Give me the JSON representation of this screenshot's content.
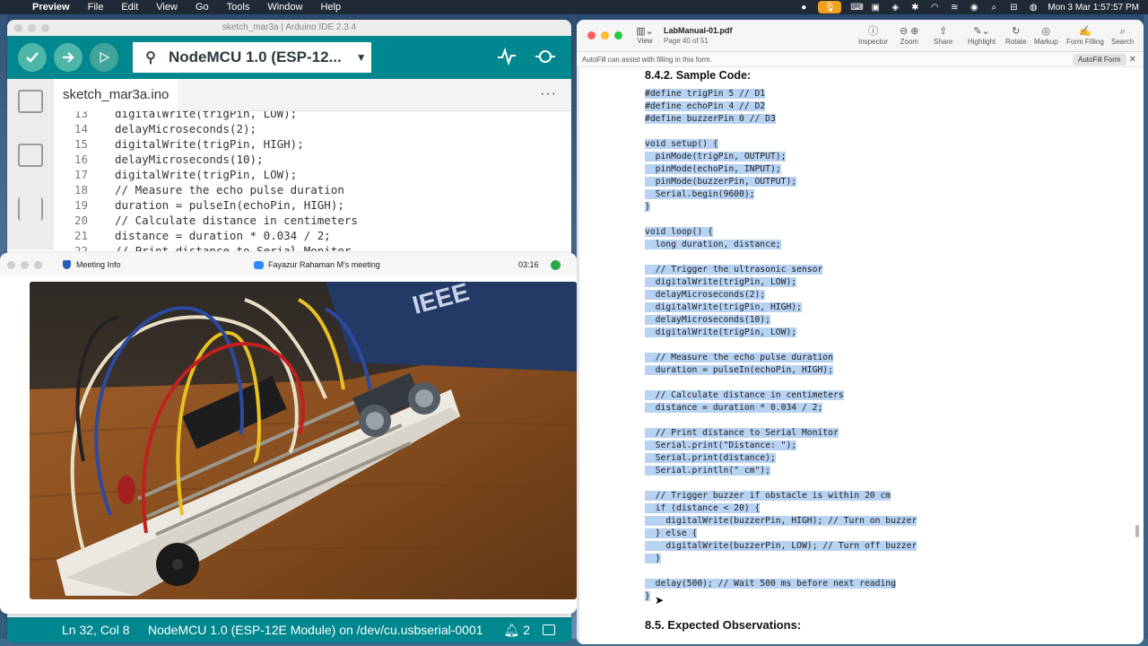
{
  "menubar": {
    "app": "Preview",
    "items": [
      "File",
      "Edit",
      "View",
      "Go",
      "Tools",
      "Window",
      "Help"
    ],
    "datetime": "Mon 3 Mar  1:57:57 PM"
  },
  "arduino": {
    "window_title": "sketch_mar3a | Arduino IDE 2.3.4",
    "board": "NodeMCU 1.0 (ESP-12...",
    "tab_file": "sketch_mar3a.ino",
    "tab_more": "···",
    "code_lines": [
      {
        "n": "13",
        "t": "digitalWrite(trigPin, LOW);"
      },
      {
        "n": "14",
        "t": "delayMicroseconds(2);"
      },
      {
        "n": "15",
        "t": "digitalWrite(trigPin, HIGH);"
      },
      {
        "n": "16",
        "t": "delayMicroseconds(10);"
      },
      {
        "n": "17",
        "t": "digitalWrite(trigPin, LOW);"
      },
      {
        "n": "18",
        "t": "// Measure the echo pulse duration"
      },
      {
        "n": "19",
        "t": "duration = pulseIn(echoPin, HIGH);"
      },
      {
        "n": "20",
        "t": "// Calculate distance in centimeters"
      },
      {
        "n": "21",
        "t": "distance = duration * 0.034 / 2;"
      },
      {
        "n": "22",
        "t": "// Print distance to Serial Monitor"
      }
    ],
    "status": {
      "position": "Ln 32, Col 8",
      "board_port": "NodeMCU 1.0 (ESP-12E Module) on /dev/cu.usbserial-0001",
      "notifications": "2"
    }
  },
  "meeting": {
    "info_label": "Meeting Info",
    "name": "Fayazur Rahaman M's meeting",
    "elapsed": "03:16",
    "video_text": "IEEE"
  },
  "preview": {
    "doc_name": "LabManual-01.pdf",
    "page_info": "Page 40 of 51",
    "view_label": "View",
    "tools": [
      "Inspector",
      "Zoom",
      "Share",
      "Highlight",
      "Rotate",
      "Markup",
      "Form Filling",
      "Search"
    ],
    "autofill_text": "AutoFill can assist with filling in this form.",
    "autofill_button": "AutoFill Form",
    "section_heading": "8.4.2.  Sample Code:",
    "pdf_code": [
      "#define trigPin 5 // D1",
      "#define echoPin 4 // D2",
      "#define buzzerPin 0 // D3",
      "",
      "void setup() {",
      "  pinMode(trigPin, OUTPUT);",
      "  pinMode(echoPin, INPUT);",
      "  pinMode(buzzerPin, OUTPUT);",
      "  Serial.begin(9600);",
      "}",
      "",
      "void loop() {",
      "  long duration, distance;",
      "",
      "  // Trigger the ultrasonic sensor",
      "  digitalWrite(trigPin, LOW);",
      "  delayMicroseconds(2);",
      "  digitalWrite(trigPin, HIGH);",
      "  delayMicroseconds(10);",
      "  digitalWrite(trigPin, LOW);",
      "",
      "  // Measure the echo pulse duration",
      "  duration = pulseIn(echoPin, HIGH);",
      "",
      "  // Calculate distance in centimeters",
      "  distance = duration * 0.034 / 2;",
      "",
      "  // Print distance to Serial Monitor",
      "  Serial.print(\"Distance: \");",
      "  Serial.print(distance);",
      "  Serial.println(\" cm\");",
      "",
      "  // Trigger buzzer if obstacle is within 20 cm",
      "  if (distance < 20) {",
      "    digitalWrite(buzzerPin, HIGH); // Turn on buzzer",
      "  } else {",
      "    digitalWrite(buzzerPin, LOW); // Turn off buzzer",
      "  }",
      "",
      "  delay(500); // Wait 500 ms before next reading",
      "}"
    ],
    "next_heading": "8.5.  Expected Observations:"
  },
  "colors": {
    "arduino_teal": "#00878f",
    "selection": "#b7d2f3",
    "menubar": "#1f2a36"
  }
}
